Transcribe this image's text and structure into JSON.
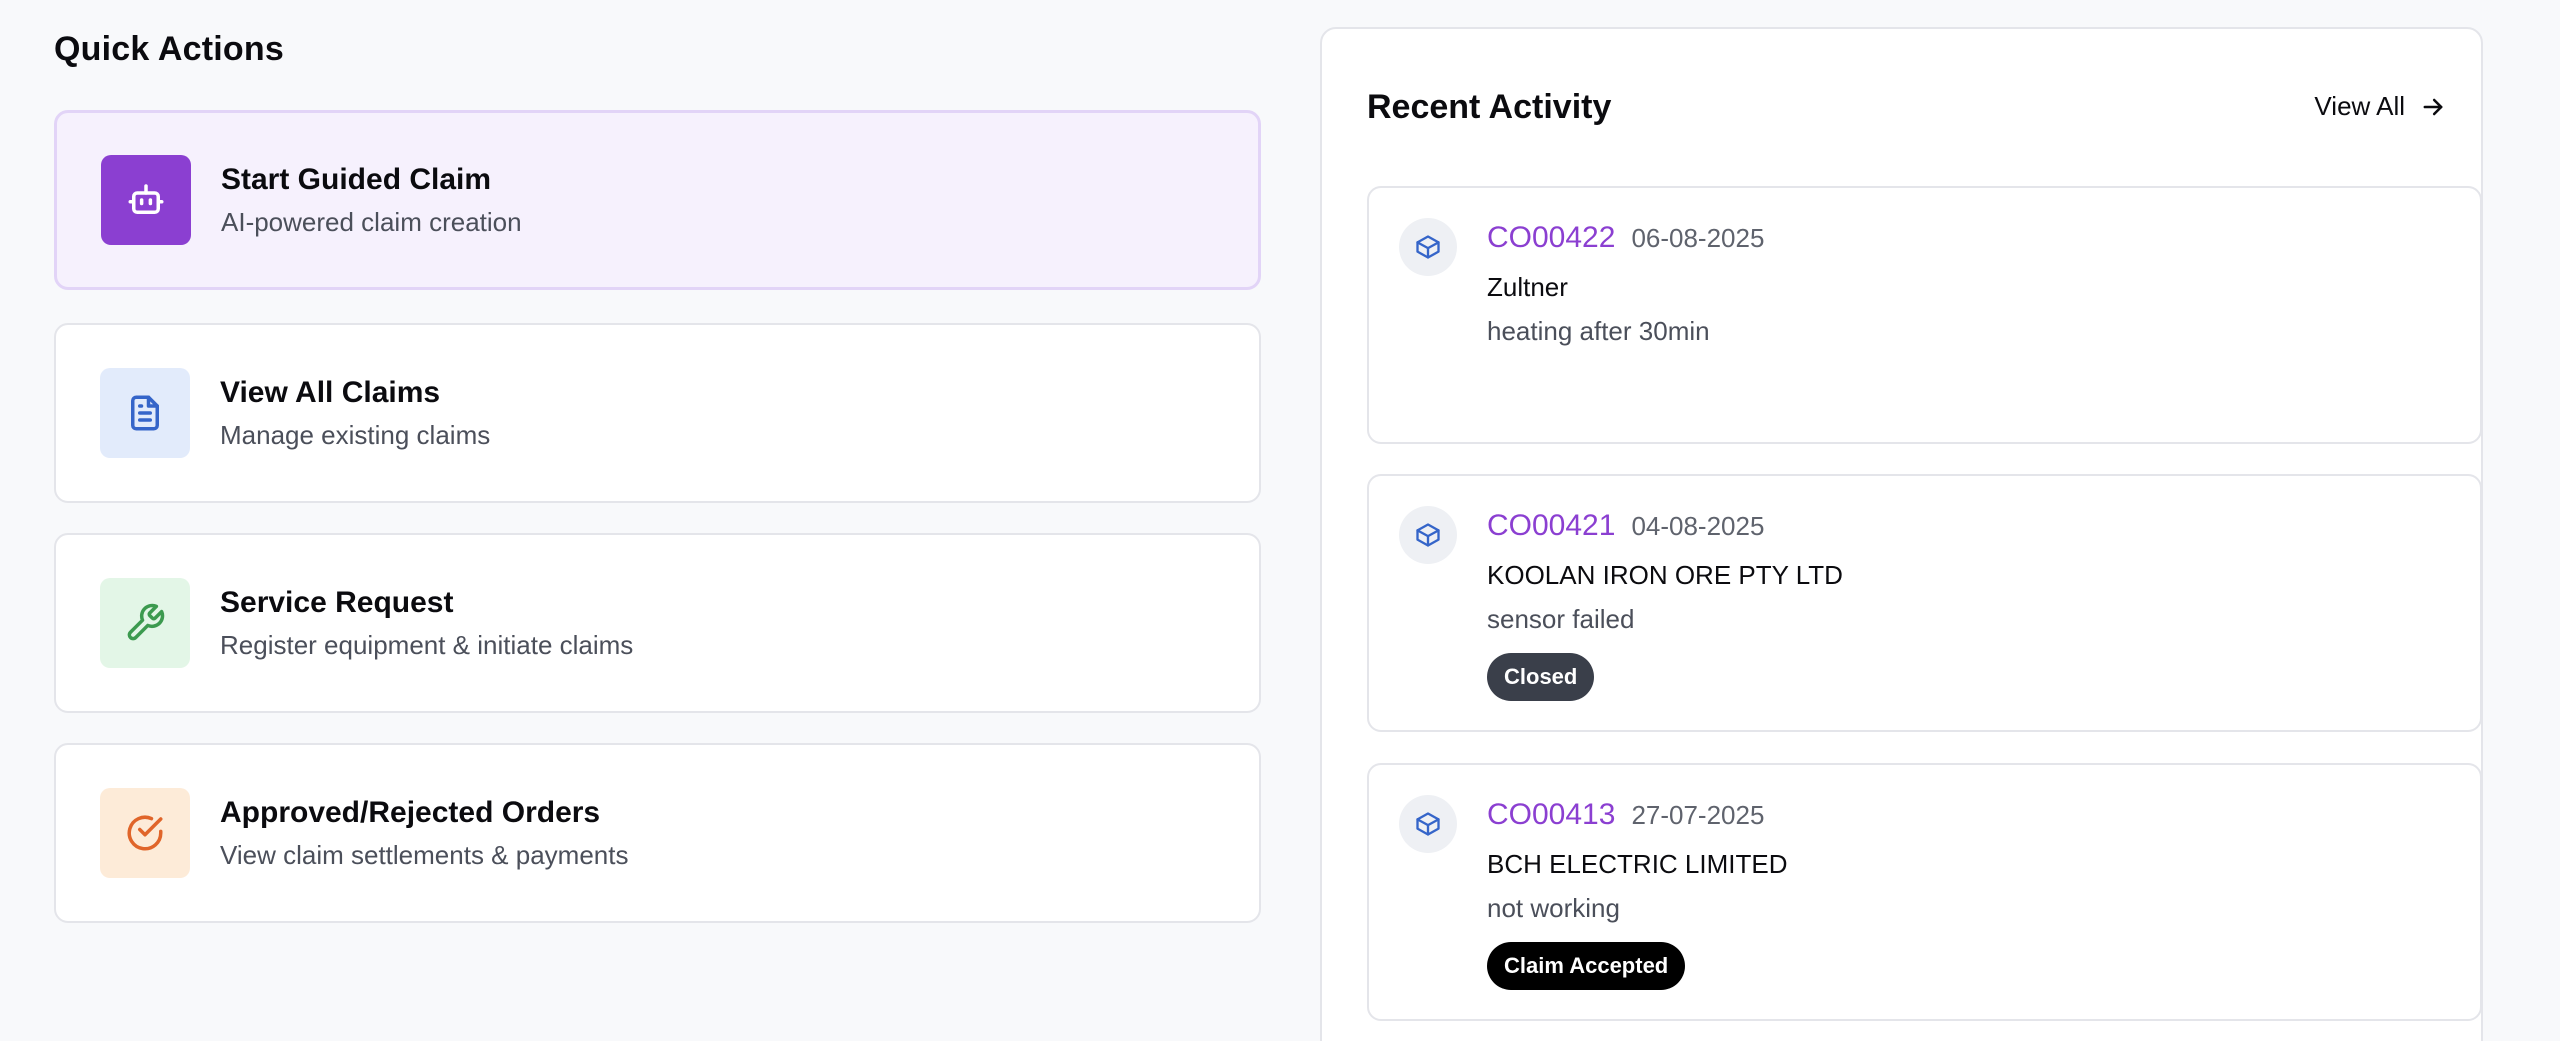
{
  "quick_actions": {
    "title": "Quick Actions",
    "items": [
      {
        "label": "Start Guided Claim",
        "sub": "AI-powered claim creation",
        "icon": "robot-icon",
        "icon_bg": "#8b3fd1",
        "icon_color": "#ffffff"
      },
      {
        "label": "View All Claims",
        "sub": "Manage existing claims",
        "icon": "document-icon",
        "icon_bg": "#e2ebfb",
        "icon_color": "#3565c9"
      },
      {
        "label": "Service Request",
        "sub": "Register equipment & initiate claims",
        "icon": "wrench-icon",
        "icon_bg": "#e3f6e7",
        "icon_color": "#3c9a4f"
      },
      {
        "label": "Approved/Rejected Orders",
        "sub": "View claim settlements & payments",
        "icon": "check-circle-icon",
        "icon_bg": "#fdebd8",
        "icon_color": "#e0652a"
      }
    ]
  },
  "recent_activity": {
    "title": "Recent Activity",
    "view_all": "View All",
    "items": [
      {
        "id": "CO00422",
        "date": "06-08-2025",
        "company": "Zultner",
        "desc": "heating after 30min",
        "status": ""
      },
      {
        "id": "CO00421",
        "date": "04-08-2025",
        "company": "KOOLAN IRON ORE PTY LTD",
        "desc": "sensor failed",
        "status": "Closed",
        "status_color": "#3a3f4a"
      },
      {
        "id": "CO00413",
        "date": "27-07-2025",
        "company": "BCH ELECTRIC LIMITED",
        "desc": "not working",
        "status": "Claim Accepted",
        "status_color": "#000000"
      }
    ]
  },
  "colors": {
    "accent": "#8b3fd1",
    "package_icon": "#3565c9"
  }
}
